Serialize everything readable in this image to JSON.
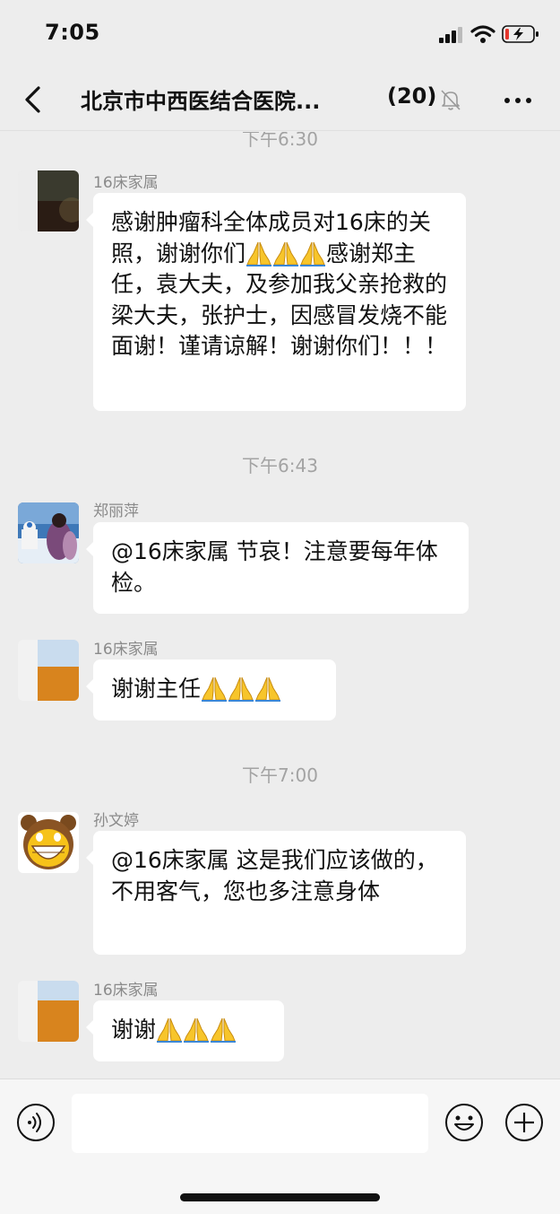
{
  "status_bar": {
    "time": "7:05"
  },
  "header": {
    "title": "北京市中西医结合医院...",
    "member_count": "(20)",
    "muted": true
  },
  "chat": {
    "partial_timestamp": "下午6:30",
    "messages": [
      {
        "sender": "16床家属",
        "text": "感谢肿瘤科全体成员对16床的关照，谢谢你们🙏🙏🙏感谢郑主任，袁大夫，及参加我父亲抢救的梁大夫，张护士，因感冒发烧不能面谢！谨请谅解！谢谢你们！！！"
      },
      {
        "timestamp": "下午6:43"
      },
      {
        "sender": "郑丽萍",
        "text": "@16床家属 节哀！注意要每年体检。"
      },
      {
        "sender": "16床家属",
        "text": "谢谢主任🙏🙏🙏"
      },
      {
        "timestamp": "下午7:00"
      },
      {
        "sender": "孙文婷",
        "text": "@16床家属 这是我们应该做的，不用客气，您也多注意身体"
      },
      {
        "sender": "16床家属",
        "text": "谢谢🙏🙏🙏"
      }
    ]
  },
  "input_bar": {
    "message_value": ""
  },
  "colors": {
    "background": "#ededed",
    "bubble": "#ffffff",
    "timestamp": "#a3a3a3",
    "sender": "#8a8a8a"
  },
  "icons": [
    "back-arrow-icon",
    "mute-bell-icon",
    "more-dots-icon",
    "voice-icon",
    "emoji-icon",
    "plus-icon",
    "praying-hands-emoji"
  ]
}
